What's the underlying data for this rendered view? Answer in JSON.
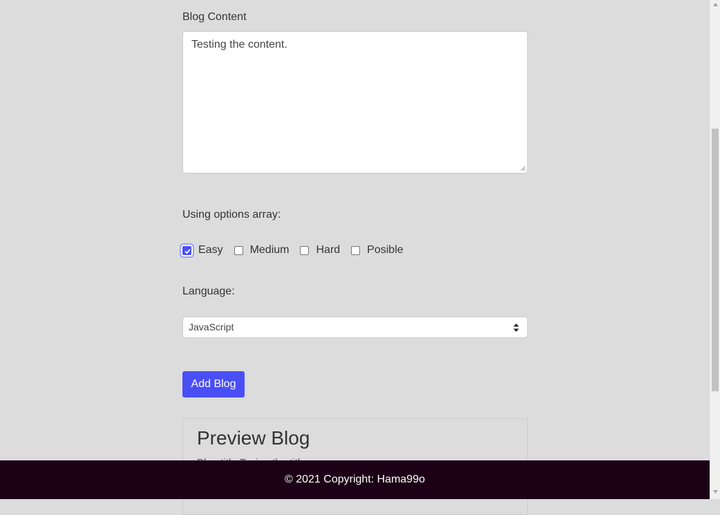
{
  "form": {
    "content_label": "Blog Content",
    "content_value": "Testing the content.",
    "options_label": "Using options array:",
    "options": [
      {
        "label": "Easy",
        "checked": true
      },
      {
        "label": "Medium",
        "checked": false
      },
      {
        "label": "Hard",
        "checked": false
      },
      {
        "label": "Posible",
        "checked": false
      }
    ],
    "language_label": "Language:",
    "language_selected": "JavaScript",
    "submit_label": "Add Blog"
  },
  "preview": {
    "title": "Preview Blog",
    "text": "Blog title:Tesing the title"
  },
  "footer": {
    "copyright": "© 2021 Copyright: Hama99o"
  },
  "colors": {
    "background": "#dcdcdc",
    "accent": "#4a4ff5",
    "footer": "#1c0015"
  }
}
